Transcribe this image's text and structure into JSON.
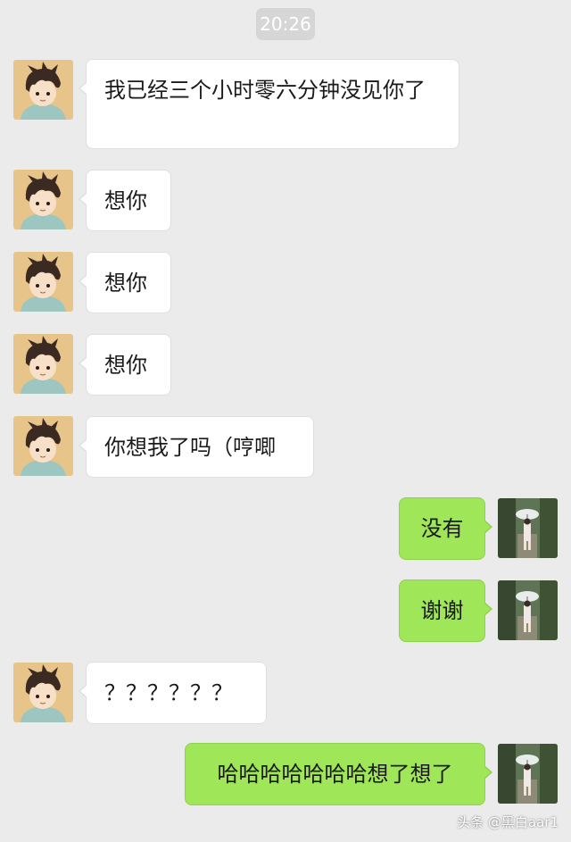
{
  "timestamp": "20:26",
  "messages": [
    {
      "side": "left",
      "text": "我已经三个小时零六分钟没见你了"
    },
    {
      "side": "left",
      "text": "想你"
    },
    {
      "side": "left",
      "text": "想你"
    },
    {
      "side": "left",
      "text": "想你"
    },
    {
      "side": "left",
      "text": "你想我了吗（哼唧"
    },
    {
      "side": "right",
      "text": "没有"
    },
    {
      "side": "right",
      "text": "谢谢"
    },
    {
      "side": "left",
      "text": "？？？？？？"
    },
    {
      "side": "right",
      "text": "哈哈哈哈哈哈哈想了想了"
    }
  ],
  "avatars": {
    "left": "cartoon-boy-avatar",
    "right": "girl-umbrella-photo-avatar"
  },
  "colors": {
    "background": "#ebebeb",
    "left_bubble": "#ffffff",
    "right_bubble": "#9fe658",
    "time_pill": "#d6d6d6"
  },
  "watermark": "头条 @黑白aar1"
}
